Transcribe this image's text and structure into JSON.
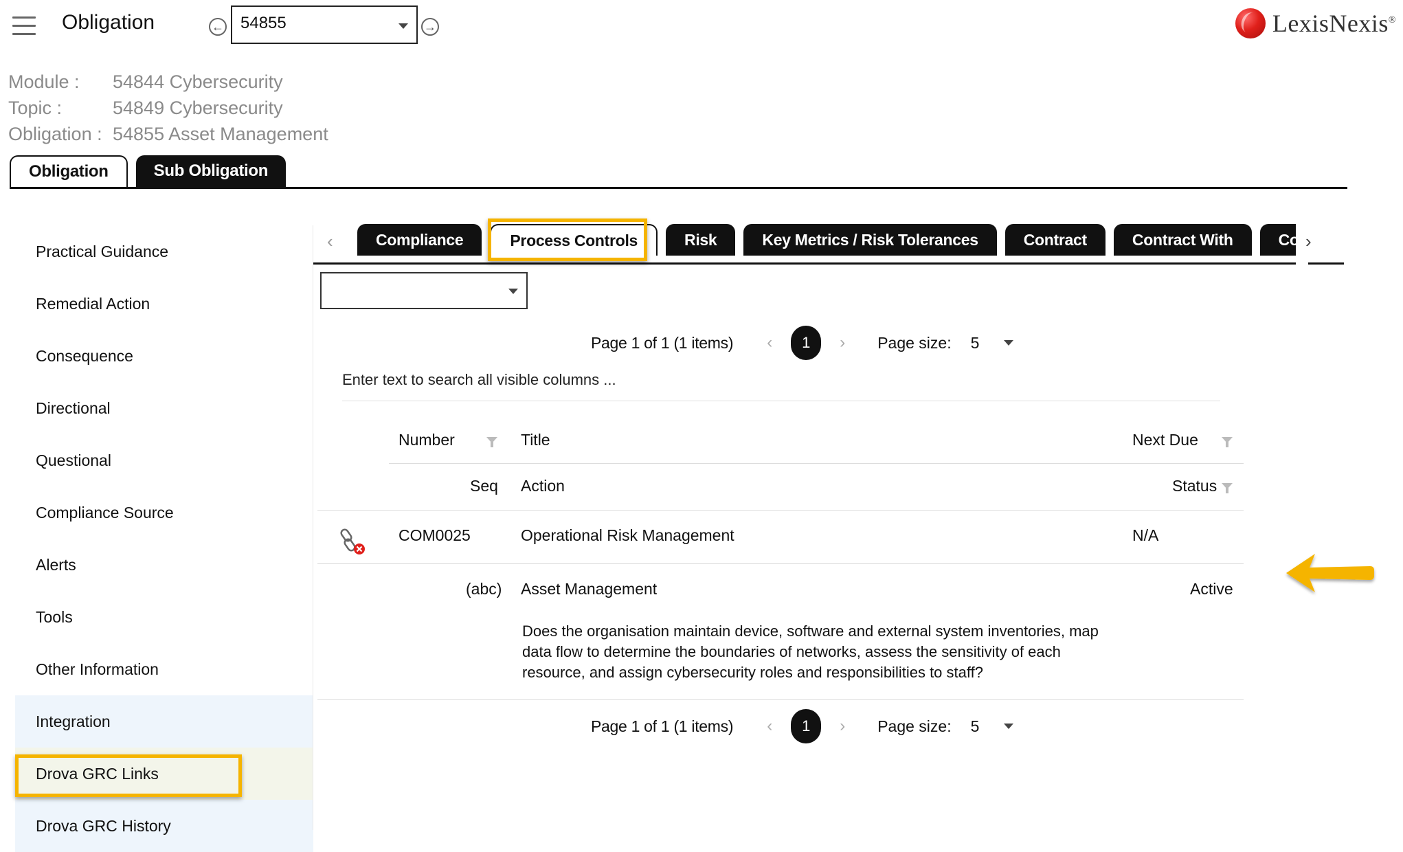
{
  "header": {
    "title": "Obligation",
    "obligation_id": "54855"
  },
  "brand": {
    "name": "LexisNexis",
    "reg": "®"
  },
  "meta": {
    "module_label": "Module :",
    "module_value": "54844 Cybersecurity",
    "topic_label": "Topic :",
    "topic_value": "54849 Cybersecurity",
    "obligation_label": "Obligation :",
    "obligation_value": "54855 Asset Management"
  },
  "top_tabs": [
    "Obligation",
    "Sub Obligation"
  ],
  "left_nav": [
    "Practical Guidance",
    "Remedial Action",
    "Consequence",
    "Directional",
    "Questional",
    "Compliance Source",
    "Alerts",
    "Tools",
    "Other Information",
    "Integration",
    "Drova GRC Links",
    "Drova GRC History"
  ],
  "sub_tabs": [
    "Compliance",
    "Process Controls",
    "Risk",
    "Key Metrics / Risk Tolerances",
    "Contract",
    "Contract With",
    "Control Performance"
  ],
  "pager": {
    "info": "Page 1 of 1 (1 items)",
    "current_page": "1",
    "page_size_label": "Page size:",
    "page_size": "5"
  },
  "search": {
    "placeholder": "Enter text to search all visible columns ..."
  },
  "grid": {
    "headers": {
      "number": "Number",
      "title": "Title",
      "next_due": "Next Due",
      "seq": "Seq",
      "action": "Action",
      "status": "Status"
    },
    "row": {
      "number": "COM0025",
      "title": "Operational Risk Management",
      "next_due": "N/A",
      "seq": "(abc)",
      "action": "Asset Management",
      "status": "Active",
      "description": "Does the organisation maintain device, software and external system inventories, map data flow to determine the boundaries of networks, assess the sensitivity of each resource, and assign cybersecurity roles and responsibilities to staff?"
    }
  },
  "colors": {
    "highlight": "#f5b400",
    "tab_dark": "#111111",
    "nav_blue": "#eef5fc",
    "unlink_red": "#e0201b"
  }
}
